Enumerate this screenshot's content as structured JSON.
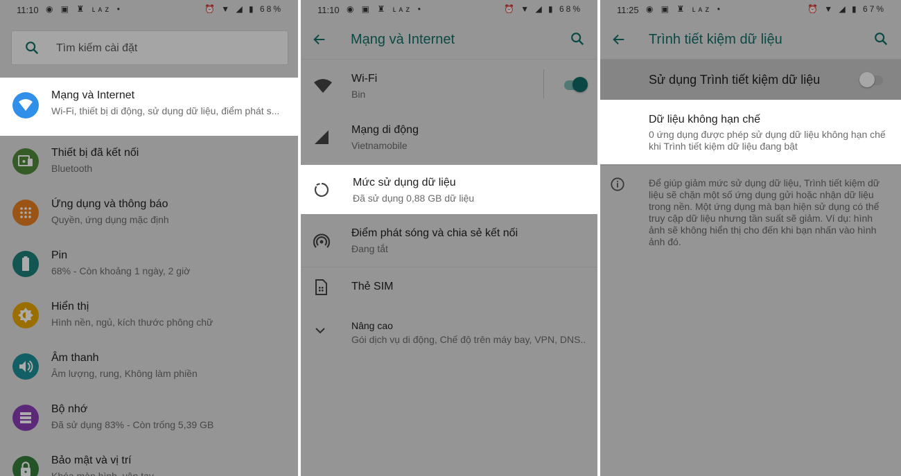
{
  "colors": {
    "accent": "#116e68",
    "toggle_on_knob": "#0f6b66",
    "toggle_on_track": "#79b5b1",
    "toggle_off_knob": "#fafafa",
    "toggle_off_track": "#b8b8b8",
    "wifi_blue": "#2f8fe9",
    "connected_green": "#4f8a3a",
    "apps_orange": "#e67e22",
    "battery_teal": "#1d7f7a",
    "display_amber": "#e8a400",
    "sound_teal": "#1b8e97",
    "storage_purple": "#8a3db4",
    "security_green": "#357d3b"
  },
  "panel1": {
    "status": {
      "time": "11:10",
      "battery": "68%"
    },
    "search_placeholder": "Tìm kiếm cài đặt",
    "items": [
      {
        "title": "Mạng và Internet",
        "subtitle": "Wi-Fi, thiết bị di động, sử dụng dữ liệu, điểm phát s...",
        "icon": "wifi-icon",
        "color": "#2f8fe9"
      },
      {
        "title": "Thiết bị đã kết nối",
        "subtitle": "Bluetooth",
        "icon": "connected-devices-icon",
        "color": "#4f8a3a"
      },
      {
        "title": "Ứng dụng và thông báo",
        "subtitle": "Quyền, ứng dụng mặc định",
        "icon": "apps-grid-icon",
        "color": "#e67e22"
      },
      {
        "title": "Pin",
        "subtitle": "68% - Còn khoảng 1 ngày, 2 giờ",
        "icon": "battery-icon",
        "color": "#1d7f7a"
      },
      {
        "title": "Hiển thị",
        "subtitle": "Hình nền, ngủ, kích thước phông chữ",
        "icon": "brightness-icon",
        "color": "#e8a400"
      },
      {
        "title": "Âm thanh",
        "subtitle": "Âm lượng, rung, Không làm phiền",
        "icon": "volume-icon",
        "color": "#1b8e97"
      },
      {
        "title": "Bộ nhớ",
        "subtitle": "Đã sử dụng 83% - Còn trống 5,39 GB",
        "icon": "storage-icon",
        "color": "#8a3db4"
      },
      {
        "title": "Bảo mật và vị trí",
        "subtitle": "Khóa màn hình, vân tay",
        "icon": "lock-icon",
        "color": "#357d3b"
      }
    ]
  },
  "panel2": {
    "status": {
      "time": "11:10",
      "battery": "68%"
    },
    "title": "Mạng và Internet",
    "wifi": {
      "title": "Wi-Fi",
      "subtitle": "Bin",
      "enabled": true
    },
    "mobile": {
      "title": "Mạng di động",
      "subtitle": "Vietnamobile"
    },
    "data_usage": {
      "title": "Mức sử dụng dữ liệu",
      "subtitle": "Đã sử dụng 0,88 GB dữ liệu"
    },
    "hotspot": {
      "title": "Điểm phát sóng và chia sẻ kết nối",
      "subtitle": "Đang tắt"
    },
    "sim": {
      "title": "Thẻ SIM"
    },
    "advanced": {
      "title": "Nâng cao",
      "subtitle": "Gói dịch vụ di động, Chế độ trên máy bay, VPN, DNS.."
    }
  },
  "panel3": {
    "status": {
      "time": "11:25",
      "battery": "67%"
    },
    "title": "Trình tiết kiệm dữ liệu",
    "master": {
      "label": "Sử dụng Trình tiết kiệm dữ liệu",
      "enabled": false
    },
    "unrestricted": {
      "title": "Dữ liệu không hạn chế",
      "subtitle": "0 ứng dụng được phép sử dụng dữ liệu không hạn chế khi Trình tiết kiệm dữ liệu đang bật"
    },
    "info": "Để giúp giảm mức sử dụng dữ liệu, Trình tiết kiệm dữ liệu sẽ chặn một số ứng dụng gửi hoặc nhận dữ liệu trong nền. Một ứng dụng mà bạn hiện sử dụng có thể truy cập dữ liệu nhưng tần suất sẽ giảm. Ví dụ: hình ảnh sẽ không hiển thị cho đến khi bạn nhấn vào hình ảnh đó."
  }
}
